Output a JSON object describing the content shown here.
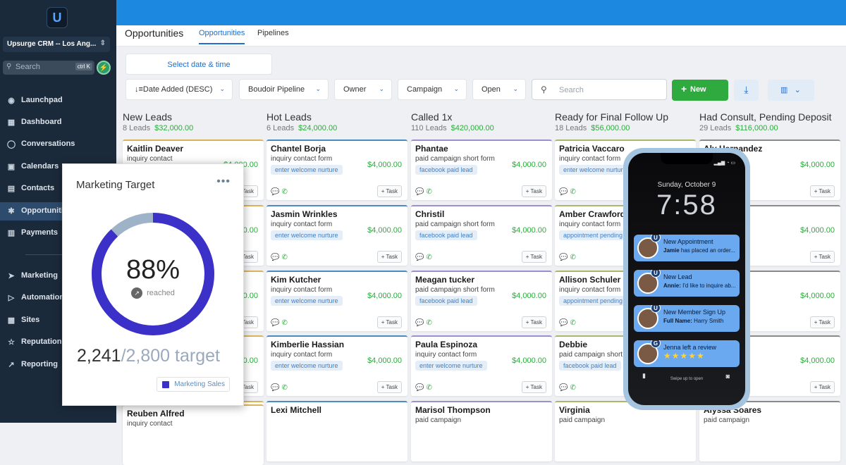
{
  "sidebar": {
    "logo": "U",
    "account": "Upsurge CRM -- Los Ang...",
    "account_chevron": "⇕",
    "search_placeholder": "Search",
    "search_shortcut": "ctrl K",
    "items": [
      {
        "label": "Launchpad",
        "icon": "rocket-icon",
        "glyph": "◉"
      },
      {
        "label": "Dashboard",
        "icon": "dashboard-icon",
        "glyph": "▦"
      },
      {
        "label": "Conversations",
        "icon": "chat-icon",
        "glyph": "◯"
      },
      {
        "label": "Calendars",
        "icon": "calendar-icon",
        "glyph": "▣"
      },
      {
        "label": "Contacts",
        "icon": "contacts-icon",
        "glyph": "▤"
      },
      {
        "label": "Opportunities",
        "icon": "opportunities-icon",
        "glyph": "✱"
      },
      {
        "label": "Payments",
        "icon": "payments-icon",
        "glyph": "▥"
      },
      {
        "label": "Marketing",
        "icon": "marketing-icon",
        "glyph": "➤"
      },
      {
        "label": "Automation",
        "icon": "automation-icon",
        "glyph": "▷"
      },
      {
        "label": "Sites",
        "icon": "sites-icon",
        "glyph": "▩"
      },
      {
        "label": "Reputation",
        "icon": "star-icon",
        "glyph": "☆"
      },
      {
        "label": "Reporting",
        "icon": "reporting-icon",
        "glyph": "↗"
      }
    ]
  },
  "header": {
    "page_title": "Opportunities",
    "tabs": [
      "Opportunities",
      "Pipelines"
    ]
  },
  "toolbar": {
    "date_picker": "Select date & time",
    "sort": "Date Added (DESC)",
    "pipeline": "Boudoir Pipeline",
    "owner": "Owner",
    "campaign": "Campaign",
    "status": "Open",
    "search_placeholder": "Search",
    "new_label": "New",
    "chevron": "⌄"
  },
  "columns": [
    {
      "title": "New Leads",
      "count": "8 Leads",
      "amount": "$32,000.00",
      "cards": [
        {
          "name": "Kaitlin Deaver",
          "source": "inquiry contact",
          "value": "$4,000.00",
          "tag": "",
          "task": "+ Task"
        },
        {
          "name": "",
          "source": "",
          "value": "$4,000.00",
          "tag": "",
          "task": "+ Task"
        },
        {
          "name": "",
          "source": "",
          "value": "$4,000.00",
          "tag": "",
          "task": "+ Task"
        },
        {
          "name": "",
          "source": "",
          "value": "$4,000.00",
          "tag": "",
          "task": "+ Task"
        },
        {
          "name": "",
          "source": "",
          "value": "$4,000.00",
          "tag": "",
          "task": "+ Task"
        },
        {
          "name": "Reuben Alfred",
          "source": "inquiry contact",
          "value": "",
          "tag": "",
          "task": ""
        }
      ]
    },
    {
      "title": "Hot Leads",
      "count": "6 Leads",
      "amount": "$24,000.00",
      "cards": [
        {
          "name": "Chantel Borja",
          "source": "inquiry contact form",
          "value": "$4,000.00",
          "tag": "enter welcome nurture",
          "task": "+ Task"
        },
        {
          "name": "Jasmin Wrinkles",
          "source": "inquiry contact form",
          "value": "$4,000.00",
          "tag": "enter welcome nurture",
          "task": "+ Task"
        },
        {
          "name": "Kim Kutcher",
          "source": "inquiry contact form",
          "value": "$4,000.00",
          "tag": "enter welcome nurture",
          "task": "+ Task"
        },
        {
          "name": "Kimberlie Hassian",
          "source": "inquiry contact form",
          "value": "$4,000.00",
          "tag": "enter welcome nurture",
          "task": "+ Task"
        },
        {
          "name": "Lexi Mitchell",
          "source": "",
          "value": "",
          "tag": "",
          "task": ""
        }
      ]
    },
    {
      "title": "Called 1x",
      "count": "110 Leads",
      "amount": "$420,000.00",
      "cards": [
        {
          "name": "Phantae",
          "source": "paid campaign short form",
          "value": "$4,000.00",
          "tag": "facebook paid lead",
          "task": "+ Task"
        },
        {
          "name": "Christil",
          "source": "paid campaign short form",
          "value": "$4,000.00",
          "tag": "facebook paid lead",
          "task": "+ Task"
        },
        {
          "name": "Meagan tucker",
          "source": "paid campaign short form",
          "value": "$4,000.00",
          "tag": "facebook paid lead",
          "task": "+ Task"
        },
        {
          "name": "Paula Espinoza",
          "source": "inquiry contact form",
          "value": "$4,000.00",
          "tag": "enter welcome nurture",
          "task": "+ Task"
        },
        {
          "name": "Marisol Thompson",
          "source": "paid campaign",
          "value": "",
          "tag": "",
          "task": ""
        }
      ]
    },
    {
      "title": "Ready for Final Follow Up",
      "count": "18 Leads",
      "amount": "$56,000.00",
      "cards": [
        {
          "name": "Patricia Vaccaro",
          "source": "inquiry contact form",
          "value": "$4,000.00",
          "tag": "enter welcome nurture",
          "task": "+ Task"
        },
        {
          "name": "Amber Crawford",
          "source": "inquiry contact form",
          "value": "$4,000.00",
          "tag": "appointment pending",
          "task": "+ Task"
        },
        {
          "name": "Allison Schuler",
          "source": "inquiry contact form",
          "value": "$4,000.00",
          "tag": "appointment pending",
          "task": "+ Task"
        },
        {
          "name": "Debbie",
          "source": "paid campaign short form",
          "value": "$4,000.00",
          "tag": "facebook paid lead",
          "task": "+ Task"
        },
        {
          "name": "Virginia",
          "source": "paid campaign",
          "value": "",
          "tag": "",
          "task": ""
        }
      ]
    },
    {
      "title": "Had Consult, Pending Deposit",
      "count": "29 Leads",
      "amount": "$116,000.00",
      "cards": [
        {
          "name": "Aly Hernandez",
          "source": "",
          "value": "$4,000.00",
          "tag": "nurture",
          "task": "+ Task"
        },
        {
          "name": "wley",
          "source": "",
          "value": "$4,000.00",
          "tag": "nurture",
          "task": "+ Task"
        },
        {
          "name": "ley",
          "source": "",
          "value": "$4,000.00",
          "tag": "lead",
          "task": "+ Task"
        },
        {
          "name": "",
          "source": "",
          "value": "$4,000.00",
          "tag": "flodesk",
          "task": "+ Task"
        },
        {
          "name": "Alyssa Soares",
          "source": "paid campaign",
          "value": "",
          "tag": "",
          "task": ""
        }
      ]
    }
  ],
  "marketing_target": {
    "title": "Marketing Target",
    "menu": "•••",
    "percent_label": "88%",
    "percent_value": 0.88,
    "reached_label": "reached",
    "current": "2,241",
    "target": "/2,800 target",
    "legend": "Marketing Sales",
    "ring_color": "#3b31c9",
    "track_color": "#9fb3c8"
  },
  "phone": {
    "date": "Sunday, October 9",
    "time": "7:58",
    "status": "▂▄▆ ◔ ▭",
    "swipe": "Swipe up to open",
    "notifications": [
      {
        "title": "New Appointment",
        "who": "Jamie",
        "text": " has placed an order...",
        "badge": "U"
      },
      {
        "title": "New Lead",
        "who": "Annie:",
        "text": " I'd like to inquire ab...",
        "badge": "U"
      },
      {
        "title": "New Member Sign Up",
        "who": "Full Name:",
        "text": " Harry Smith",
        "badge": "U"
      },
      {
        "title": "Jenna left a review",
        "who": "",
        "text": "",
        "stars": "★★★★★",
        "badge": "G"
      }
    ]
  },
  "colors": {
    "accent": "#1d88e0",
    "green": "#2eaa3e",
    "sidebar": "#1b2a3b"
  }
}
